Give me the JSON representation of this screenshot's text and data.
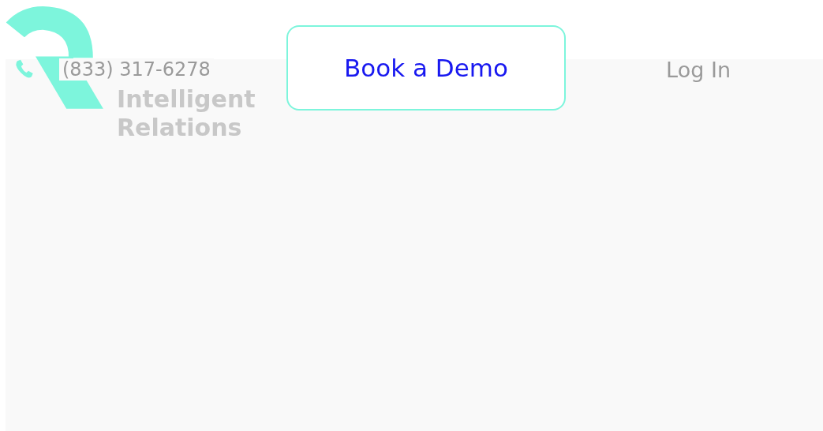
{
  "logo": {
    "lines": [
      "Intelligent",
      "Relations"
    ]
  },
  "phone": {
    "number": "(833) 317-6278"
  },
  "demo_button": {
    "label": "Book a Demo"
  },
  "login": {
    "label": "Log In"
  }
}
